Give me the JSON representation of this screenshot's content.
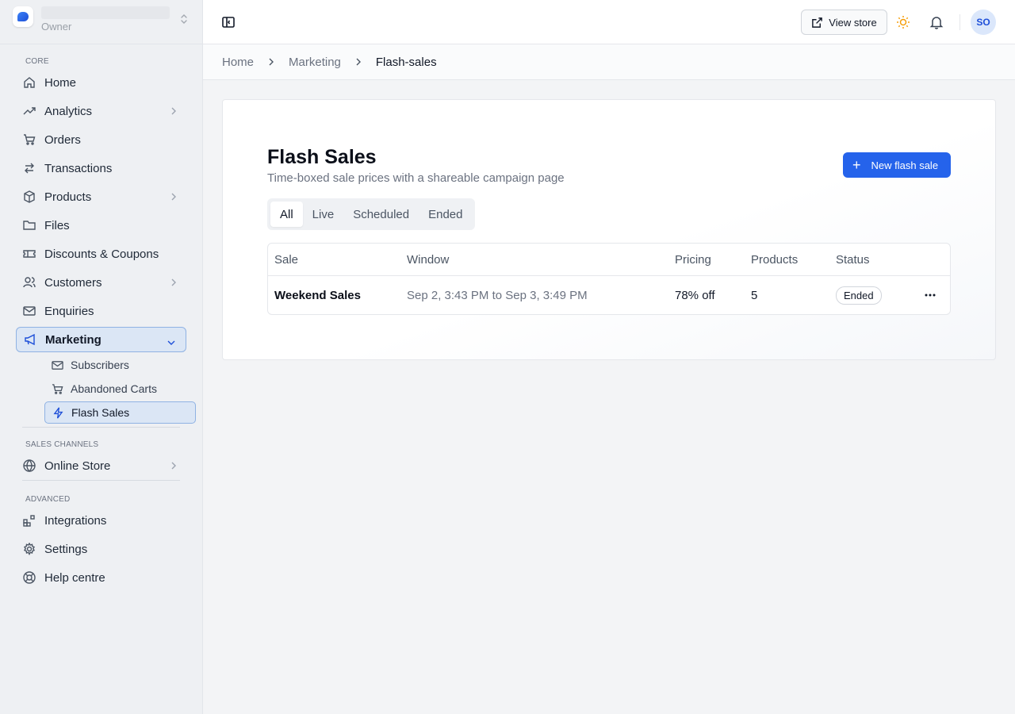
{
  "brand": {
    "role": "Owner"
  },
  "sidebar": {
    "sections": {
      "core": "CORE",
      "sales_channels": "SALES CHANNELS",
      "advanced": "ADVANCED"
    },
    "items": {
      "home": "Home",
      "analytics": "Analytics",
      "orders": "Orders",
      "transactions": "Transactions",
      "products": "Products",
      "files": "Files",
      "discounts": "Discounts & Coupons",
      "customers": "Customers",
      "enquiries": "Enquiries",
      "marketing": "Marketing",
      "subscribers": "Subscribers",
      "abandoned_carts": "Abandoned Carts",
      "flash_sales": "Flash Sales",
      "online_store": "Online Store",
      "integrations": "Integrations",
      "settings": "Settings",
      "help_centre": "Help centre"
    }
  },
  "topbar": {
    "view_store": "View store",
    "avatar_initials": "SO"
  },
  "breadcrumb": [
    "Home",
    "Marketing",
    "Flash-sales"
  ],
  "page": {
    "title": "Flash Sales",
    "subtitle": "Time-boxed sale prices with a shareable campaign page",
    "new_button": "New flash sale",
    "tabs": [
      "All",
      "Live",
      "Scheduled",
      "Ended"
    ],
    "active_tab": "All"
  },
  "table": {
    "columns": [
      "Sale",
      "Window",
      "Pricing",
      "Products",
      "Status"
    ],
    "rows": [
      {
        "sale": "Weekend Sales",
        "window": "Sep 2, 3:43 PM to Sep 3, 3:49 PM",
        "pricing": "78% off",
        "products": "5",
        "status": "Ended"
      }
    ]
  },
  "colors": {
    "accent": "#2563eb",
    "active_bg": "#dbe6f5",
    "active_border": "#8fb2e3"
  }
}
